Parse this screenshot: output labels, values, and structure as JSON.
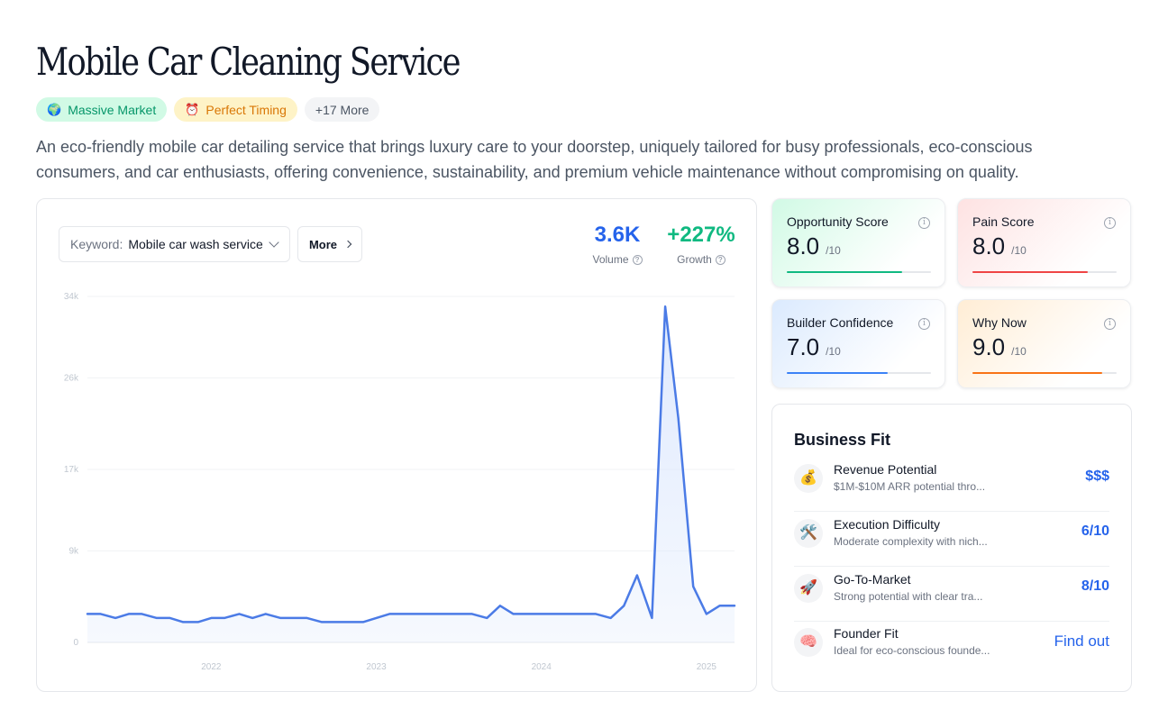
{
  "page": {
    "title": "Mobile Car Cleaning Service",
    "description": "An eco-friendly mobile car detailing service that brings luxury care to your doorstep, uniquely tailored for busy professionals, eco-conscious consumers, and car enthusiasts, offering convenience, sustainability, and premium vehicle maintenance without compromising on quality."
  },
  "tags": [
    {
      "emoji": "🌍",
      "label": "Massive Market",
      "color": "#059669"
    },
    {
      "emoji": "⏰",
      "label": "Perfect Timing",
      "color": "#d97706"
    },
    {
      "label": "+17 More"
    }
  ],
  "trend": {
    "keyword_label": "Keyword:",
    "keyword_value": "Mobile car wash service",
    "more_label": "More",
    "volume_value": "3.6K",
    "volume_label": "Volume",
    "volume_color": "#2563eb",
    "growth_value": "+227%",
    "growth_label": "Growth",
    "growth_color": "#10b981",
    "help_icon": "?"
  },
  "chart_data": {
    "type": "area",
    "y_ticks": [
      "34k",
      "26k",
      "17k",
      "9k",
      "0"
    ],
    "y_tick_values": [
      34000,
      26000,
      17000,
      9000,
      0
    ],
    "x_ticks": [
      "2022",
      "2023",
      "2024",
      "2025"
    ],
    "x_tick_values": [
      2022.0,
      2023.0,
      2024.0,
      2025.0
    ],
    "xlim": [
      2021.25,
      2025.17
    ],
    "ylim": [
      0,
      34000
    ],
    "grid": true,
    "line_color": "#4b7be6",
    "fill_color": "#dbe7fd",
    "series": [
      {
        "x": [
          2021.25,
          2021.33,
          2021.42,
          2021.5,
          2021.58,
          2021.67,
          2021.75,
          2021.83,
          2021.92,
          2022.0,
          2022.08,
          2022.17,
          2022.25,
          2022.33,
          2022.42,
          2022.5,
          2022.58,
          2022.67,
          2022.75,
          2022.83,
          2022.92,
          2023.0,
          2023.08,
          2023.17,
          2023.25,
          2023.33,
          2023.42,
          2023.5,
          2023.58,
          2023.67,
          2023.75,
          2023.83,
          2023.92,
          2024.0,
          2024.08,
          2024.17,
          2024.25,
          2024.33,
          2024.42,
          2024.5,
          2024.58,
          2024.67,
          2024.75,
          2024.83,
          2024.92,
          2025.0,
          2025.08,
          2025.17
        ],
        "y": [
          2800,
          2800,
          2400,
          2800,
          2800,
          2400,
          2400,
          2000,
          2000,
          2400,
          2400,
          2800,
          2400,
          2800,
          2400,
          2400,
          2400,
          2000,
          2000,
          2000,
          2000,
          2400,
          2800,
          2800,
          2800,
          2800,
          2800,
          2800,
          2800,
          2400,
          3600,
          2800,
          2800,
          2800,
          2800,
          2800,
          2800,
          2800,
          2400,
          3600,
          6600,
          2400,
          33000,
          22000,
          5500,
          2800,
          3600,
          3600
        ]
      }
    ]
  },
  "scores": [
    {
      "title": "Opportunity Score",
      "value": "8.0",
      "unit": "/10",
      "fraction": 0.8,
      "color": "#10b981"
    },
    {
      "title": "Pain Score",
      "value": "8.0",
      "unit": "/10",
      "fraction": 0.8,
      "color": "#ef4444"
    },
    {
      "title": "Builder Confidence",
      "value": "7.0",
      "unit": "/10",
      "fraction": 0.7,
      "color": "#3b82f6"
    },
    {
      "title": "Why Now",
      "value": "9.0",
      "unit": "/10",
      "fraction": 0.9,
      "color": "#f97316"
    }
  ],
  "info_icon": "i",
  "business_fit": {
    "title": "Business Fit",
    "rows": [
      {
        "icon": "💰",
        "icon_name": "money-bag-icon",
        "name": "Revenue Potential",
        "desc": "$1M-$10M ARR potential thro...",
        "value": "$$$"
      },
      {
        "icon": "🛠️",
        "icon_name": "tools-icon",
        "name": "Execution Difficulty",
        "desc": "Moderate complexity with nich...",
        "value": "6/10"
      },
      {
        "icon": "🚀",
        "icon_name": "rocket-icon",
        "name": "Go-To-Market",
        "desc": "Strong potential with clear tra...",
        "value": "8/10"
      },
      {
        "icon": "🧠",
        "icon_name": "brain-icon",
        "name": "Founder Fit",
        "desc": "Ideal for eco-conscious founde...",
        "value": "Find out"
      }
    ]
  }
}
